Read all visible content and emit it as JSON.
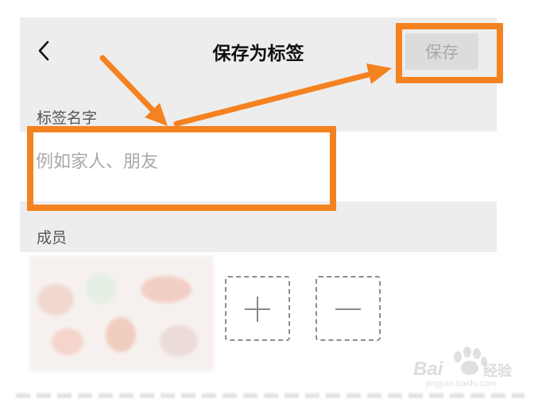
{
  "header": {
    "title": "保存为标签",
    "save_label": "保存",
    "back_icon": "chevron-left-icon"
  },
  "tag_name": {
    "label": "标签名字",
    "placeholder": "例如家人、朋友",
    "value": ""
  },
  "members": {
    "label": "成员",
    "add_icon": "plus-icon",
    "remove_icon": "minus-icon"
  },
  "annotation": {
    "highlight_color": "#f58220"
  },
  "watermark": {
    "brand_text": "Bai",
    "brand_suffix": "经验",
    "url": "jingyan.baidu.com"
  },
  "colors": {
    "header_background": "#ededed",
    "save_button_background": "#dcdcdc",
    "save_button_text": "#a9a9a9",
    "placeholder_text": "#a9a9a9"
  }
}
